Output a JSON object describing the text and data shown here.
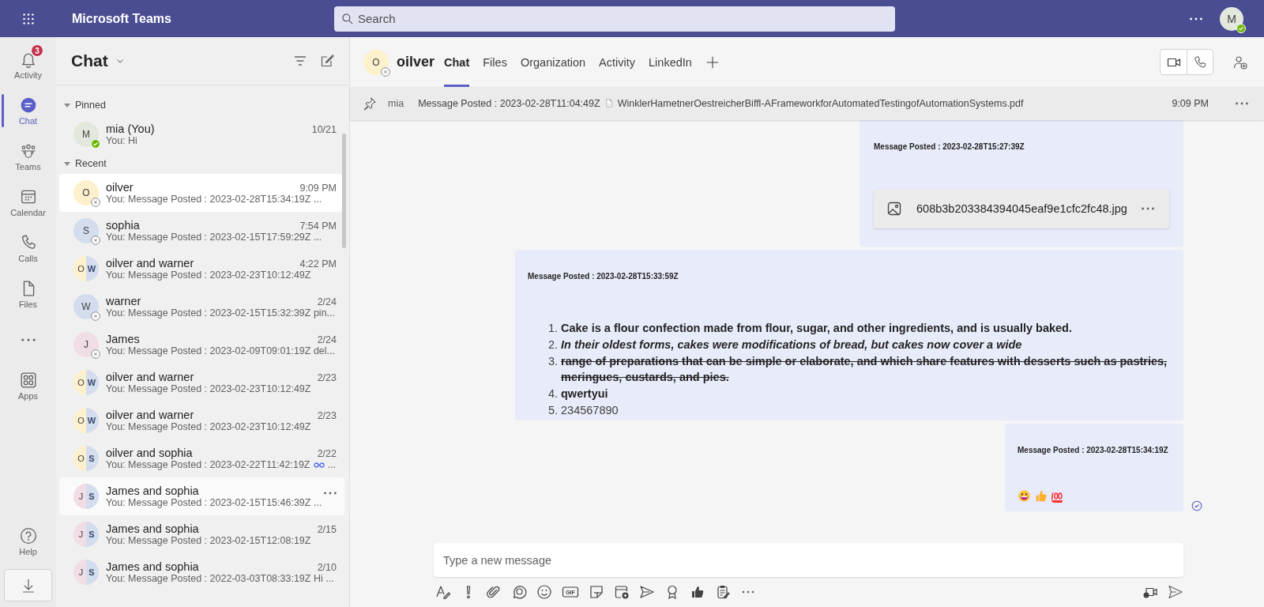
{
  "top_bar": {
    "app_name": "Microsoft Teams",
    "search": {
      "placeholder": "Search"
    },
    "user_avatar": {
      "initial": "M",
      "color": "#e3e8dc",
      "available": true
    }
  },
  "rail": {
    "items": [
      {
        "label": "Activity",
        "badge": "3",
        "selected": false
      },
      {
        "label": "Chat",
        "selected": true
      },
      {
        "label": "Teams",
        "selected": false
      },
      {
        "label": "Calendar",
        "selected": false
      },
      {
        "label": "Calls",
        "selected": false
      },
      {
        "label": "Files",
        "selected": false
      },
      {
        "selected": false
      },
      {
        "label": "Apps",
        "selected": false
      }
    ],
    "bottom_items": [
      {
        "label": "Help",
        "selected": false
      }
    ]
  },
  "chat_list": {
    "title": "Chat",
    "sections": [
      {
        "label": "Pinned",
        "expanded": true,
        "chats": [
          {
            "name": "mia (You)",
            "time": "10/21",
            "preview": "You: Hi",
            "avatars": [
              {
                "initial": "M",
                "color": "#e3e8dc"
              }
            ],
            "available": true,
            "selected": false,
            "hovered": false
          }
        ]
      },
      {
        "label": "Recent",
        "expanded": true,
        "chats": [
          {
            "name": "oilver",
            "time": "9:09 PM",
            "preview": "You: Message Posted : 2023-02-28T15:34:19Z ...",
            "avatars": [
              {
                "initial": "O",
                "color": "#fcf1cc"
              }
            ],
            "offline": true,
            "selected": true,
            "hovered": false
          },
          {
            "name": "sophia",
            "time": "7:54 PM",
            "preview": "You: Message Posted : 2023-02-15T17:59:29Z ...",
            "avatars": [
              {
                "initial": "S",
                "color": "#d3ddee"
              }
            ],
            "offline": true,
            "selected": false,
            "hovered": false
          },
          {
            "name": "oilver and warner",
            "time": "4:22 PM",
            "preview": "You: Message Posted : 2023-02-23T10:12:49Z",
            "avatars": [
              {
                "initial": "O",
                "color": "#fcf1cc"
              },
              {
                "initial": "W",
                "color": "#d3ddee"
              }
            ],
            "selected": false,
            "hovered": false
          },
          {
            "name": "warner",
            "time": "2/24",
            "preview": "You: Message Posted : 2023-02-15T15:32:39Z pin...",
            "avatars": [
              {
                "initial": "W",
                "color": "#d3ddee"
              }
            ],
            "offline": true,
            "selected": false,
            "hovered": false
          },
          {
            "name": "James",
            "time": "2/24",
            "preview": "You: Message Posted : 2023-02-09T09:01:19Z del...",
            "avatars": [
              {
                "initial": "J",
                "color": "#f0dde6"
              }
            ],
            "offline": true,
            "selected": false,
            "hovered": false
          },
          {
            "name": "oilver and warner",
            "time": "2/23",
            "preview": "You: Message Posted : 2023-02-23T10:12:49Z",
            "avatars": [
              {
                "initial": "O",
                "color": "#fcf1cc"
              },
              {
                "initial": "W",
                "color": "#d3ddee"
              }
            ],
            "selected": false,
            "hovered": false
          },
          {
            "name": "oilver and warner",
            "time": "2/23",
            "preview": "You: Message Posted : 2023-02-23T10:12:49Z",
            "avatars": [
              {
                "initial": "O",
                "color": "#fcf1cc"
              },
              {
                "initial": "W",
                "color": "#d3ddee"
              }
            ],
            "selected": false,
            "hovered": false
          },
          {
            "name": "oilver and sophia",
            "time": "2/22",
            "preview": "You: Message Posted : 2023-02-22T11:42:19Z",
            "glasses": true,
            "preview_end": "...",
            "avatars": [
              {
                "initial": "O",
                "color": "#fcf1cc"
              },
              {
                "initial": "S",
                "color": "#d3ddee"
              }
            ],
            "selected": false,
            "hovered": false
          },
          {
            "name": "James and sophia",
            "preview": "You: Message Posted : 2023-02-15T15:46:39Z ...",
            "avatars": [
              {
                "initial": "J",
                "color": "#f0dde6"
              },
              {
                "initial": "S",
                "color": "#d3ddee"
              }
            ],
            "selected": false,
            "hovered": true
          },
          {
            "name": "James and sophia",
            "time": "2/15",
            "preview": "You: Message Posted : 2023-02-15T12:08:19Z",
            "avatars": [
              {
                "initial": "J",
                "color": "#f0dde6"
              },
              {
                "initial": "S",
                "color": "#d3ddee"
              }
            ],
            "selected": false,
            "hovered": false
          },
          {
            "name": "James and sophia",
            "time": "2/10",
            "preview": "You: Message Posted : 2022-03-03T08:33:19Z Hi ...",
            "avatars": [
              {
                "initial": "J",
                "color": "#f0dde6"
              },
              {
                "initial": "S",
                "color": "#d3ddee"
              }
            ],
            "selected": false,
            "hovered": false
          }
        ]
      }
    ]
  },
  "conversation": {
    "header": {
      "avatar": {
        "initial": "O",
        "color": "#fcf1cc",
        "offline": true
      },
      "name": "oilver",
      "tabs": [
        {
          "label": "Chat",
          "selected": true
        },
        {
          "label": "Files",
          "selected": false
        },
        {
          "label": "Organization",
          "selected": false
        },
        {
          "label": "Activity",
          "selected": false
        },
        {
          "label": "LinkedIn",
          "selected": false
        }
      ]
    },
    "pinned": {
      "sender": "mia",
      "text": "Message Posted : 2023-02-28T11:04:49Z",
      "file": "WinklerHametnerOestreicherBiffl-AFrameworkforAutomatedTestingofAutomationSystems.pdf",
      "time": "9:09 PM"
    },
    "messages": [
      {
        "kind": "file",
        "heading": "Message Posted : 2023-02-28T15:27:39Z",
        "file": "608b3b203384394045eaf9e1cfc2fc48.jpg",
        "read": false
      },
      {
        "kind": "list",
        "heading": "Message Posted : 2023-02-28T15:33:59Z",
        "read": false,
        "items": [
          {
            "number": "1.",
            "text": "Cake is a flour confection made from flour, sugar, and other ingredients, and is usually baked.",
            "bold": true,
            "italic": false,
            "strikethrough": false
          },
          {
            "number": "2.",
            "text": "In their oldest forms, cakes were modifications of bread, but cakes now cover a wide",
            "bold": true,
            "italic": true,
            "strikethrough": false
          },
          {
            "number": "3.",
            "text": "range of preparations that can be simple or elaborate, and which share features with desserts such as pastries, meringues, custards, and pies.",
            "bold": true,
            "italic": false,
            "strikethrough": true
          },
          {
            "number": "4.",
            "text": "qwertyui",
            "bold": true,
            "italic": false,
            "strikethrough": false
          },
          {
            "number": "5.",
            "text": "234567890",
            "bold": false,
            "italic": false,
            "strikethrough": false
          }
        ]
      },
      {
        "kind": "emoji",
        "heading": "Message Posted : 2023-02-28T15:34:19Z",
        "read": true
      }
    ],
    "compose": {
      "placeholder": "Type a new message",
      "gif_label": "GIF"
    }
  }
}
